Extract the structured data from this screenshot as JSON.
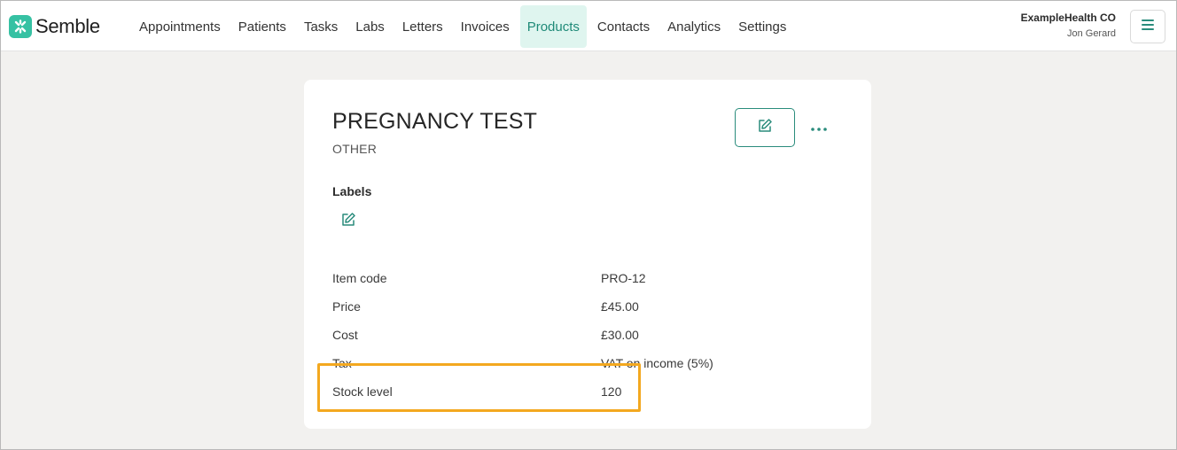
{
  "brand": {
    "name": "Semble",
    "accent": "#36c1a3"
  },
  "nav": {
    "items": [
      {
        "label": "Appointments",
        "active": false
      },
      {
        "label": "Patients",
        "active": false
      },
      {
        "label": "Tasks",
        "active": false
      },
      {
        "label": "Labs",
        "active": false
      },
      {
        "label": "Letters",
        "active": false
      },
      {
        "label": "Invoices",
        "active": false
      },
      {
        "label": "Products",
        "active": true
      },
      {
        "label": "Contacts",
        "active": false
      },
      {
        "label": "Analytics",
        "active": false
      },
      {
        "label": "Settings",
        "active": false
      }
    ]
  },
  "account": {
    "org_name": "ExampleHealth CO",
    "user_name": "Jon Gerard",
    "menu_icon": "hamburger-icon"
  },
  "product": {
    "title": "PREGNANCY TEST",
    "category": "OTHER",
    "edit_icon": "edit-icon",
    "more_icon": "more-horizontal-icon",
    "labels_heading": "Labels",
    "labels_edit_icon": "edit-icon",
    "details": [
      {
        "key": "Item code",
        "value": "PRO-12"
      },
      {
        "key": "Price",
        "value": "£45.00"
      },
      {
        "key": "Cost",
        "value": "£30.00"
      },
      {
        "key": "Tax",
        "value": "VAT on income (5%)"
      },
      {
        "key": "Stock level",
        "value": "120"
      }
    ]
  },
  "colors": {
    "primary": "#2a8c7c",
    "active_tab_bg": "#dff5ef",
    "highlight": "#f3a81f",
    "page_bg": "#f2f1ef"
  }
}
